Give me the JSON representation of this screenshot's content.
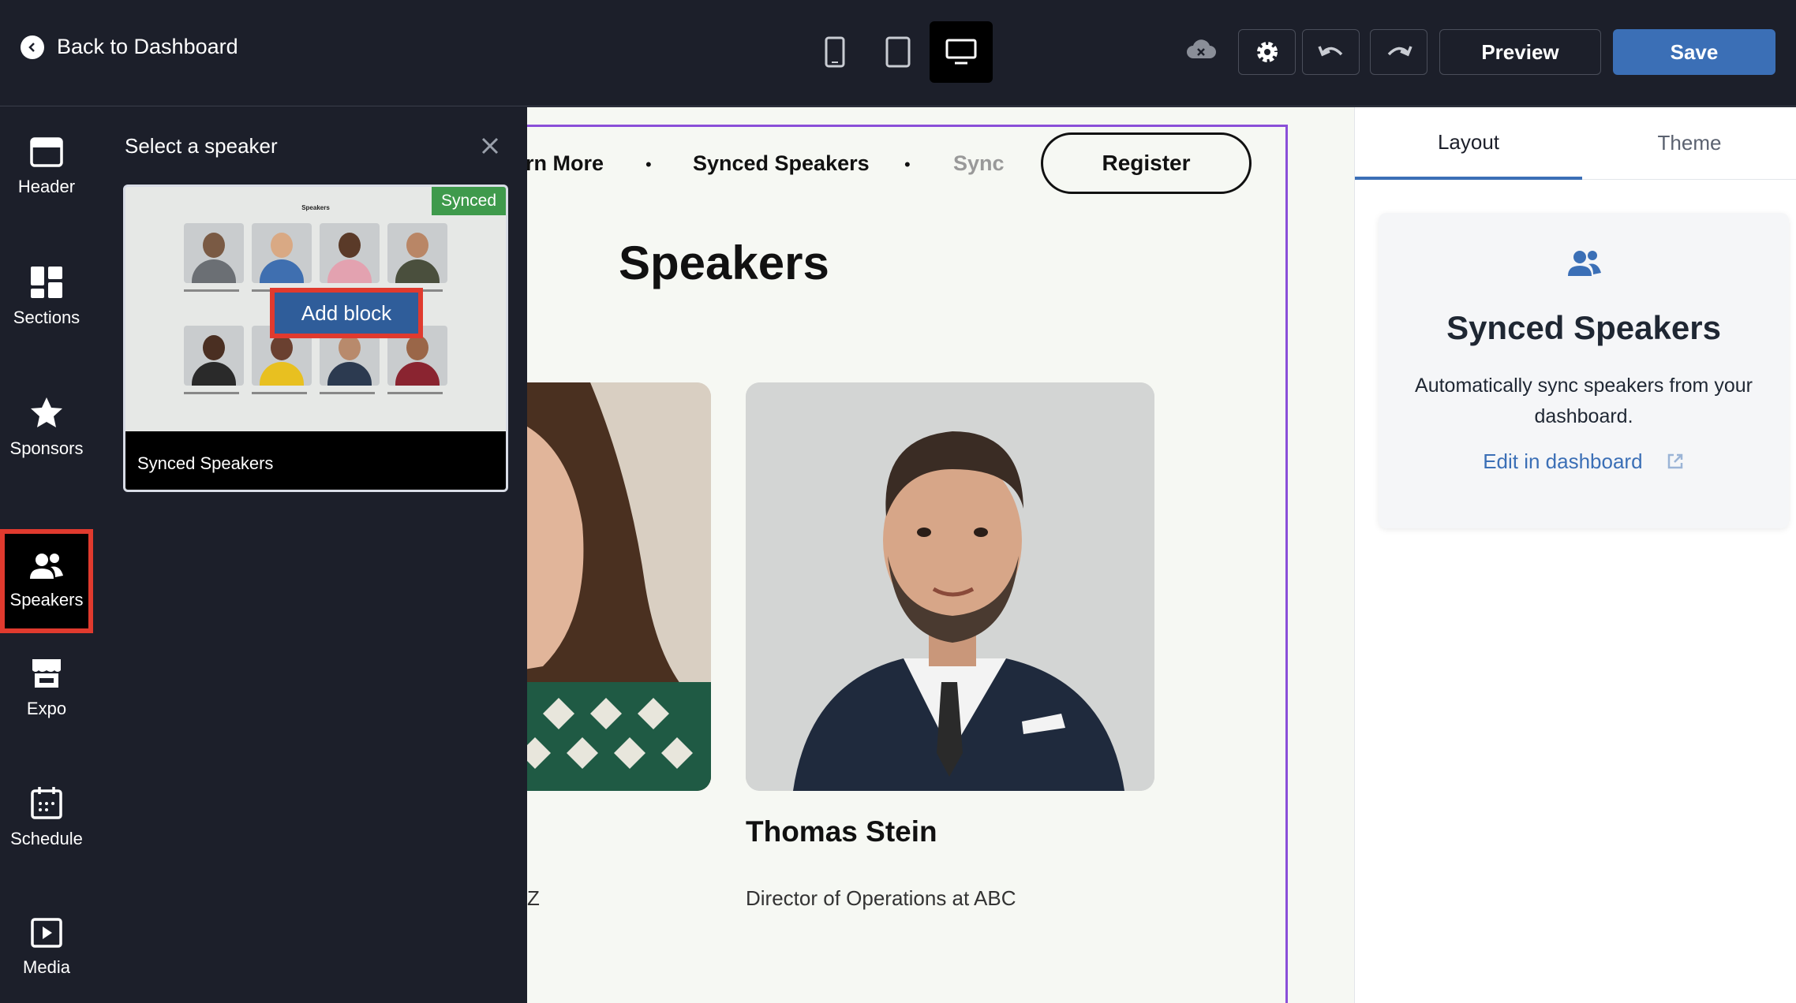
{
  "topbar": {
    "back_label": "Back to Dashboard",
    "preview_label": "Preview",
    "save_label": "Save",
    "devices": [
      "mobile-icon",
      "tablet-icon",
      "desktop-icon"
    ],
    "active_device": "desktop"
  },
  "rail": {
    "items": [
      {
        "label": "Header",
        "icon": "header-icon"
      },
      {
        "label": "Sections",
        "icon": "sections-icon"
      },
      {
        "label": "Sponsors",
        "icon": "star-icon"
      },
      {
        "label": "Speakers",
        "icon": "people-icon",
        "selected": true
      },
      {
        "label": "Expo",
        "icon": "store-icon"
      },
      {
        "label": "Schedule",
        "icon": "calendar-icon"
      },
      {
        "label": "Media",
        "icon": "play-icon"
      }
    ]
  },
  "drawer": {
    "title": "Select a speaker",
    "card": {
      "badge": "Synced",
      "thumb_title": "Speakers",
      "add_block_label": "Add block",
      "footer_label": "Synced Speakers"
    }
  },
  "canvas": {
    "nav": {
      "item1": "rn More",
      "item2": "Synced Speakers",
      "item3": "Sync",
      "register_label": "Register"
    },
    "heading": "Speakers",
    "speaker": {
      "name": "Thomas Stein",
      "role": "Director of Operations at ABC"
    },
    "cut_role": "Z"
  },
  "rpanel": {
    "tabs": [
      "Layout",
      "Theme"
    ],
    "active_tab": "Layout",
    "card": {
      "title": "Synced Speakers",
      "description": "Automatically sync speakers from your dashboard.",
      "link_label": "Edit in dashboard"
    }
  },
  "colors": {
    "accent": "#3b6fb6",
    "highlight": "#e03a2e",
    "synced_badge": "#3f9a4c",
    "frame": "#8a4fd8"
  }
}
